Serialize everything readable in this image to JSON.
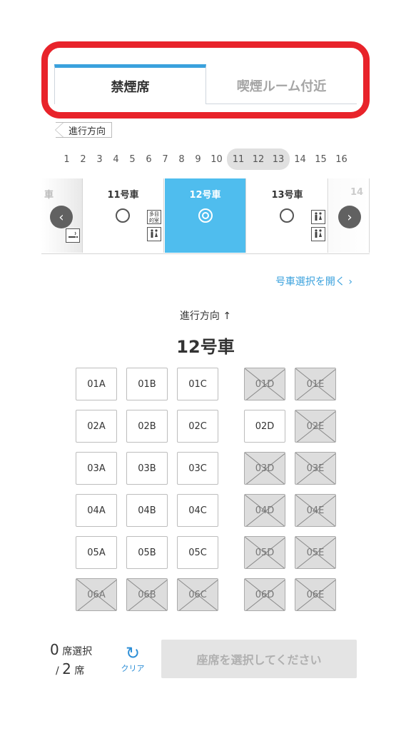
{
  "tabs": [
    {
      "label": "禁煙席",
      "active": true
    },
    {
      "label": "喫煙ルーム付近",
      "active": false
    }
  ],
  "direction_tag": "進行方向",
  "car_numbers": [
    "1",
    "2",
    "3",
    "4",
    "5",
    "6",
    "7",
    "8",
    "9",
    "10",
    "11",
    "12",
    "13",
    "14",
    "15",
    "16"
  ],
  "car_strip": {
    "partial_left_label": "車",
    "cars": [
      {
        "label": "11号車",
        "status": "available"
      },
      {
        "label": "12号車",
        "status": "selected"
      },
      {
        "label": "13号車",
        "status": "available"
      }
    ],
    "partial_right_label": "14",
    "facility_tama": "多目\n的室",
    "prev_icon": "‹",
    "next_icon": "›"
  },
  "open_car_select_link": "号車選択を開く ›",
  "direction_heading": "進行方向 ↑",
  "car_heading": "12号車",
  "seats": [
    {
      "label": "01A",
      "taken": false
    },
    {
      "label": "01B",
      "taken": false
    },
    {
      "label": "01C",
      "taken": false
    },
    {
      "label": "01D",
      "taken": true
    },
    {
      "label": "01E",
      "taken": true
    },
    {
      "label": "02A",
      "taken": false
    },
    {
      "label": "02B",
      "taken": false
    },
    {
      "label": "02C",
      "taken": false
    },
    {
      "label": "02D",
      "taken": false
    },
    {
      "label": "02E",
      "taken": true
    },
    {
      "label": "03A",
      "taken": false
    },
    {
      "label": "03B",
      "taken": false
    },
    {
      "label": "03C",
      "taken": false
    },
    {
      "label": "03D",
      "taken": true
    },
    {
      "label": "03E",
      "taken": true
    },
    {
      "label": "04A",
      "taken": false
    },
    {
      "label": "04B",
      "taken": false
    },
    {
      "label": "04C",
      "taken": false
    },
    {
      "label": "04D",
      "taken": true
    },
    {
      "label": "04E",
      "taken": true
    },
    {
      "label": "05A",
      "taken": false
    },
    {
      "label": "05B",
      "taken": false
    },
    {
      "label": "05C",
      "taken": false
    },
    {
      "label": "05D",
      "taken": true
    },
    {
      "label": "05E",
      "taken": true
    },
    {
      "label": "06A",
      "taken": true
    },
    {
      "label": "06B",
      "taken": true
    },
    {
      "label": "06C",
      "taken": true
    },
    {
      "label": "06D",
      "taken": true
    },
    {
      "label": "06E",
      "taken": true
    }
  ],
  "footer": {
    "selected_count": "0",
    "selected_label": "席選択",
    "total_prefix": "/",
    "total_count": "2",
    "total_label": "席",
    "clear_icon": "↻",
    "clear_label": "クリア",
    "submit_label": "座席を選択してください"
  }
}
